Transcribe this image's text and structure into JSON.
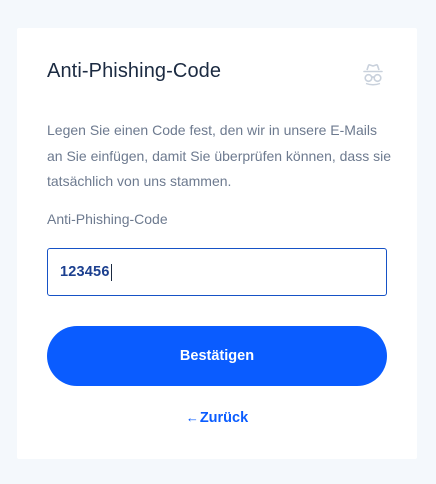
{
  "card": {
    "title": "Anti-Phishing-Code",
    "header_icon": "spy-icon",
    "description": "Legen Sie einen Code fest, den wir in unsere E-Mails an Sie einfügen, damit Sie überprüfen können, dass sie tatsächlich von uns stammen.",
    "field_label": "Anti-Phishing-Code",
    "input_value": "123456",
    "confirm_label": "Bestätigen",
    "back_arrow": "←",
    "back_label": "Zurück"
  },
  "colors": {
    "background": "#f4f8fc",
    "primary": "#0a5cff",
    "input_border": "#1652c6",
    "title": "#1b2a41",
    "muted_text": "#6d7a8f"
  }
}
